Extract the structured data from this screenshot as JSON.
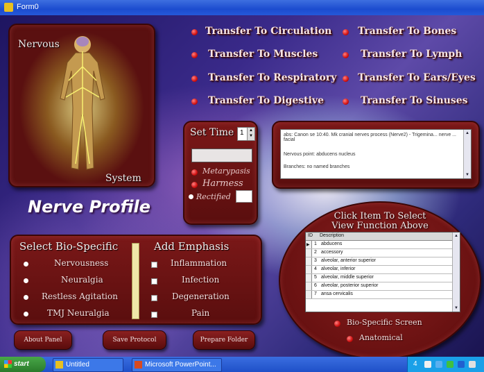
{
  "window": {
    "title": "Form0"
  },
  "body_panel": {
    "label_left": "Nervous",
    "label_right": "System"
  },
  "profile_title": "Nerve Profile",
  "transfers": [
    {
      "label": "Transfer To Circulation"
    },
    {
      "label": "Transfer To Muscles"
    },
    {
      "label": "Transfer To Respiratory"
    },
    {
      "label": "Transfer To Digestive"
    },
    {
      "label": "Transfer To Bones"
    },
    {
      "label": "Transfer To Lymph"
    },
    {
      "label": "Transfer To Ears/Eyes"
    },
    {
      "label": "Transfer To Sinuses"
    }
  ],
  "set_time": {
    "label": "Set Time",
    "spinner_value": "1",
    "time_value": "",
    "options": [
      "Metarypasis",
      "Harmess"
    ],
    "rectified_label": "Rectified",
    "rectified_value": ""
  },
  "info_box": {
    "lines": [
      "abs: Canon se 10:40. Mk cranial nerves process (Nerve2) - Trigemina... nerve ... facial",
      "Nervous point: abducens nucleus",
      "Branches: no named branches"
    ]
  },
  "functions": {
    "title_line1": "Click Item To Select",
    "title_line2": "View Function Above",
    "column_id": "ID",
    "column_name": "Description",
    "rows": [
      {
        "id": "1",
        "name": "abducens"
      },
      {
        "id": "2",
        "name": "accessory"
      },
      {
        "id": "3",
        "name": "alveolar, anterior superior"
      },
      {
        "id": "4",
        "name": "alveolar, inferior"
      },
      {
        "id": "5",
        "name": "alveolar, middle superior"
      },
      {
        "id": "6",
        "name": "alveolar, posterior superior"
      },
      {
        "id": "7",
        "name": "ansa cervicalis"
      }
    ],
    "option1": "Bio-Specific Screen",
    "option2": "Anatomical"
  },
  "bio_specific": {
    "title": "Select Bio-Specific",
    "items": [
      "Nervousness",
      "Neuralgia",
      "Restless Agitation",
      "TMJ Neuralgia"
    ]
  },
  "emphasis": {
    "title": "Add Emphasis",
    "items": [
      "Inflammation",
      "Infection",
      "Degeneration",
      "Pain"
    ]
  },
  "buttons": {
    "about": "About Panel",
    "save": "Save Protocol",
    "prepare": "Prepare Folder"
  },
  "taskbar": {
    "start_label": "start",
    "task1": "Untitled",
    "task2": "Microsoft PowerPoint...",
    "tray_text": "4"
  },
  "colors": {
    "panel": "#6e1414",
    "accent_dot": "#d01010",
    "taskbar": "#245ad8"
  }
}
